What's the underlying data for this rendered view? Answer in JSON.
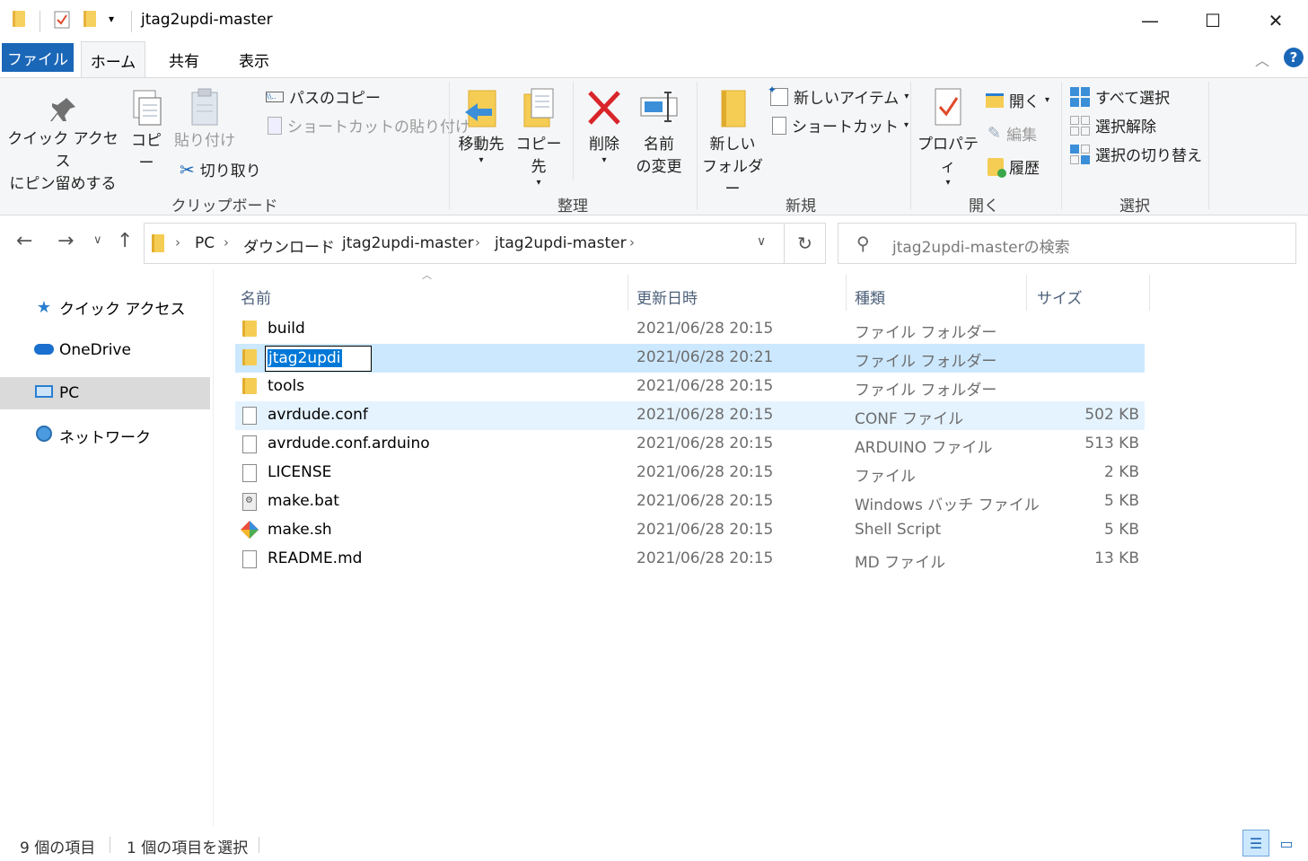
{
  "window": {
    "title": "jtag2updi-master",
    "minimize": "—",
    "maximize": "☐",
    "close": "✕"
  },
  "ribbon_tabs": {
    "file": "ファイル",
    "home": "ホーム",
    "share": "共有",
    "view": "表示",
    "help": "?"
  },
  "ribbon": {
    "clipboard": {
      "label": "クリップボード",
      "pin_line1": "クイック アクセス",
      "pin_line2": "にピン留めする",
      "copy": "コピー",
      "paste": "貼り付け",
      "copy_path": "パスのコピー",
      "paste_shortcut": "ショートカットの貼り付け",
      "cut": "切り取り"
    },
    "organize": {
      "label": "整理",
      "move_to": "移動先",
      "copy_to": "コピー先",
      "delete": "削除",
      "rename_line1": "名前",
      "rename_line2": "の変更"
    },
    "new": {
      "label": "新規",
      "new_folder_line1": "新しい",
      "new_folder_line2": "フォルダー",
      "new_item": "新しいアイテム",
      "shortcut": "ショートカット"
    },
    "open": {
      "label": "開く",
      "properties": "プロパティ",
      "open": "開く",
      "edit": "編集",
      "history": "履歴"
    },
    "select": {
      "label": "選択",
      "select_all": "すべて選択",
      "select_none": "選択解除",
      "invert": "選択の切り替え"
    }
  },
  "address": {
    "crumbs": [
      "PC",
      "ダウンロード",
      "jtag2updi-master",
      "jtag2updi-master"
    ],
    "search_placeholder": "jtag2updi-masterの検索"
  },
  "nav": {
    "quick_access": "クイック アクセス",
    "onedrive": "OneDrive",
    "pc": "PC",
    "network": "ネットワーク"
  },
  "columns": {
    "name": "名前",
    "date": "更新日時",
    "type": "種類",
    "size": "サイズ"
  },
  "files": [
    {
      "name": "build",
      "date": "2021/06/28 20:15",
      "type": "ファイル フォルダー",
      "size": "",
      "kind": "folder"
    },
    {
      "name": "jtag2updi",
      "date": "2021/06/28 20:21",
      "type": "ファイル フォルダー",
      "size": "",
      "kind": "folder"
    },
    {
      "name": "tools",
      "date": "2021/06/28 20:15",
      "type": "ファイル フォルダー",
      "size": "",
      "kind": "folder"
    },
    {
      "name": "avrdude.conf",
      "date": "2021/06/28 20:15",
      "type": "CONF ファイル",
      "size": "502 KB",
      "kind": "file"
    },
    {
      "name": "avrdude.conf.arduino",
      "date": "2021/06/28 20:15",
      "type": "ARDUINO ファイル",
      "size": "513 KB",
      "kind": "file"
    },
    {
      "name": "LICENSE",
      "date": "2021/06/28 20:15",
      "type": "ファイル",
      "size": "2 KB",
      "kind": "file"
    },
    {
      "name": "make.bat",
      "date": "2021/06/28 20:15",
      "type": "Windows バッチ ファイル",
      "size": "5 KB",
      "kind": "bat"
    },
    {
      "name": "make.sh",
      "date": "2021/06/28 20:15",
      "type": "Shell Script",
      "size": "5 KB",
      "kind": "sh"
    },
    {
      "name": "README.md",
      "date": "2021/06/28 20:15",
      "type": "MD ファイル",
      "size": "13 KB",
      "kind": "file"
    }
  ],
  "status": {
    "item_count": "9 個の項目",
    "selected": "1 個の項目を選択"
  },
  "colors": {
    "accent": "#1a67b8",
    "selection": "#cce8ff",
    "hover": "#e5f3ff"
  }
}
